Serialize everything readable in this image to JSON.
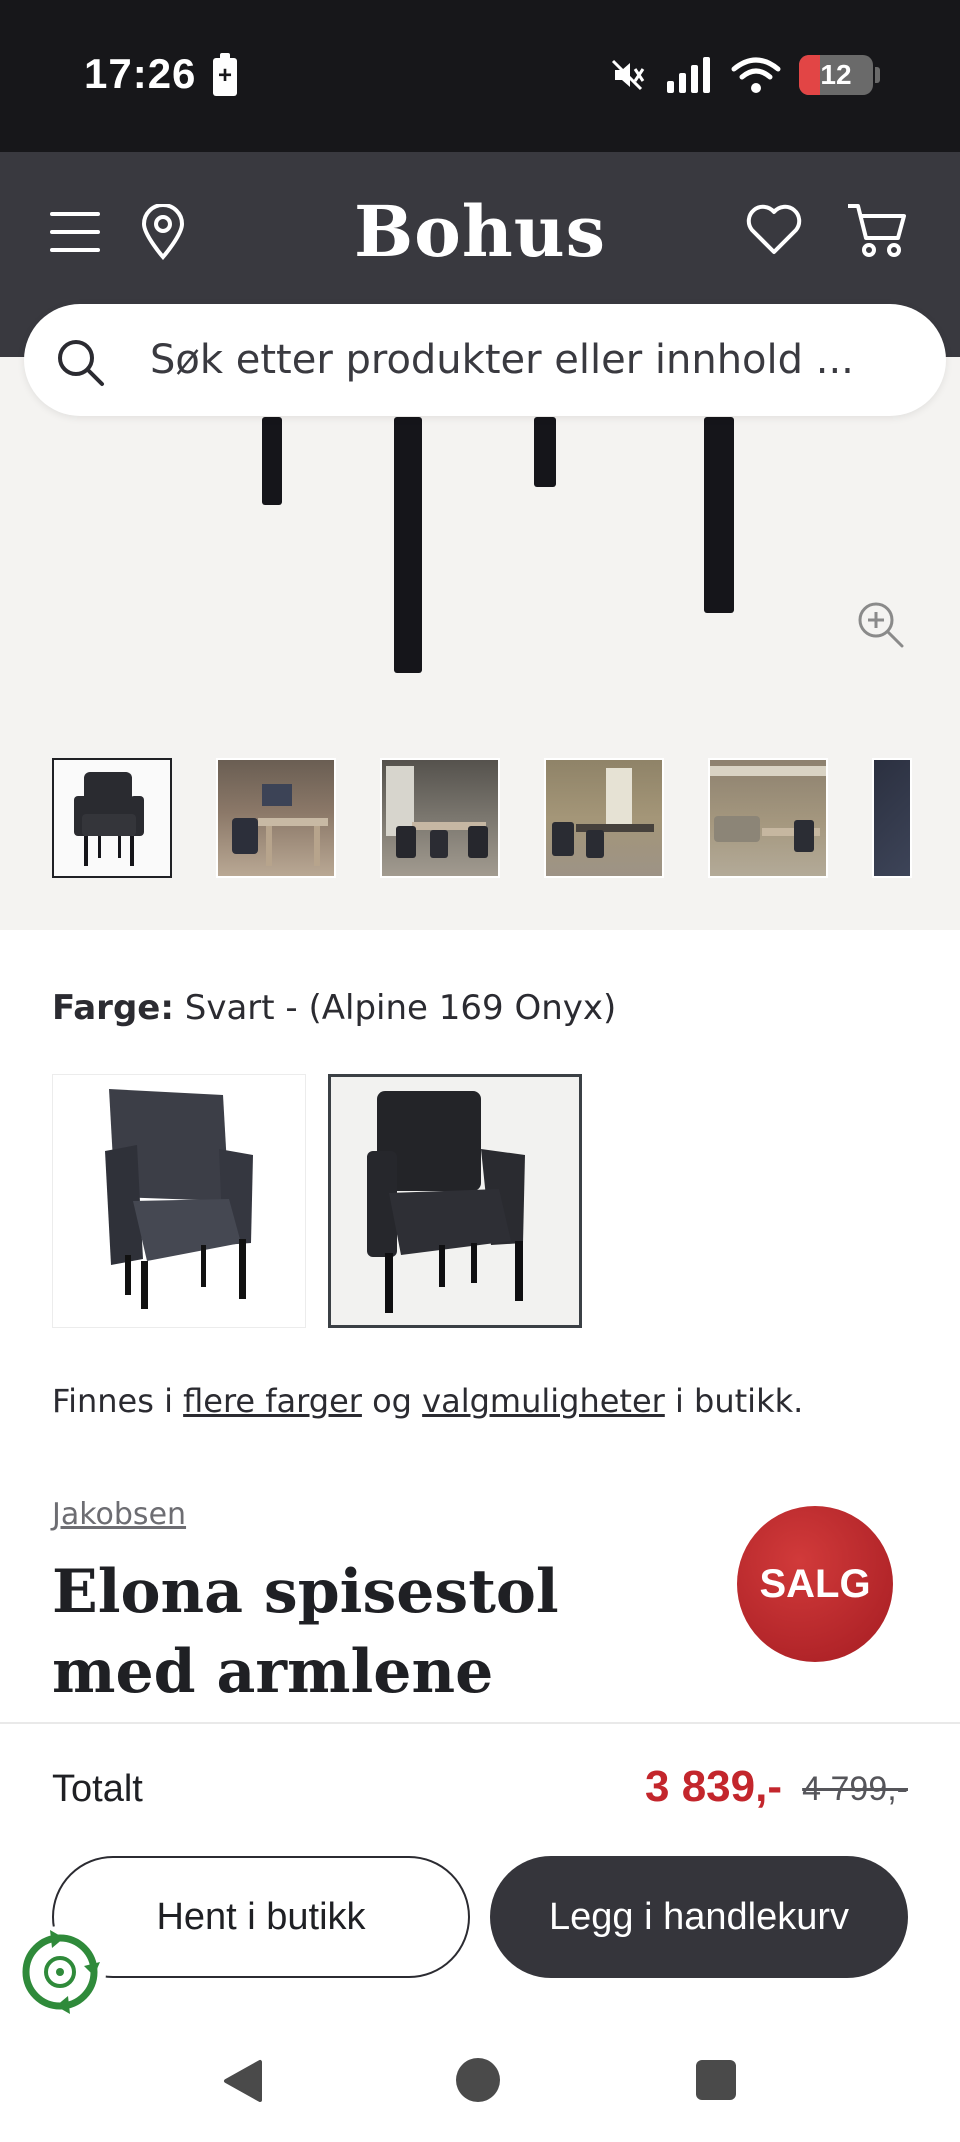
{
  "status_bar": {
    "time": "17:26",
    "battery_percent": "12",
    "icons": [
      "battery-charging-icon",
      "mute-icon",
      "signal-icon",
      "wifi-icon",
      "battery-icon"
    ]
  },
  "header": {
    "logo": "Bohus",
    "icons": [
      "menu-icon",
      "location-icon",
      "heart-icon",
      "cart-icon"
    ]
  },
  "search": {
    "placeholder": "Søk etter produkter eller innhold ..."
  },
  "gallery": {
    "thumbnail_count": 6,
    "active_index": 0,
    "zoom_icon": "zoom-in-icon"
  },
  "color": {
    "label": "Farge:",
    "value": "Svart - (Alpine 169 Onyx)",
    "swatch_count": 2,
    "selected_index": 1
  },
  "availability": {
    "prefix": "Finnes i",
    "link1": "flere farger",
    "middle": "og",
    "link2": "valgmuligheter",
    "suffix": "i butikk."
  },
  "product": {
    "brand": "Jakobsen",
    "title": "Elona spisestol med armlene",
    "badge": "SALG"
  },
  "purchase": {
    "total_label": "Totalt",
    "price": "3 839,-",
    "old_price": "4 799,-",
    "store_button": "Hent i butikk",
    "cart_button": "Legg i handlekurv"
  },
  "colors": {
    "header_bg": "#39393f",
    "sale_red": "#c3262c",
    "dark_button": "#35353b"
  }
}
